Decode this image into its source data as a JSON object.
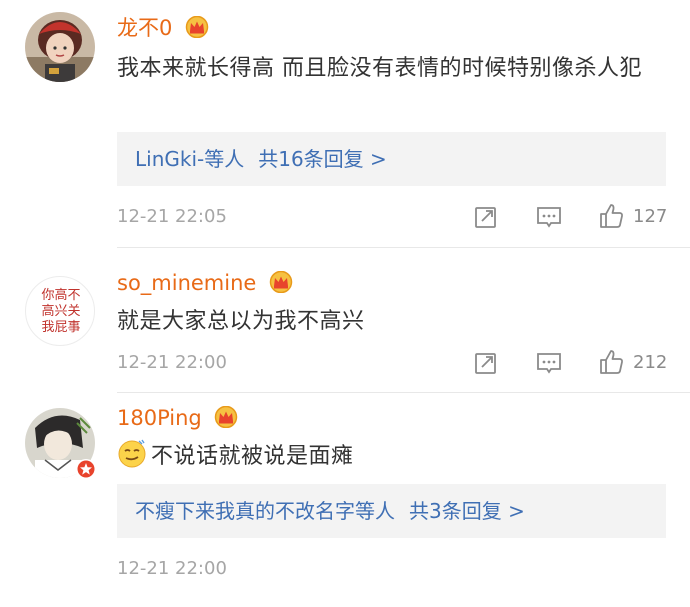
{
  "comments": [
    {
      "username": "龙不0",
      "text": "我本来就长得高  而且脸没有表情的时候特别像杀人犯",
      "replies": {
        "users": "LinGki-等人",
        "count": "共16条回复 >"
      },
      "time": "12-21 22:05",
      "likes": "127"
    },
    {
      "username": "so_minemine",
      "avatar_text": "你高不高兴关我屁事",
      "text": "就是大家总以为我不高兴",
      "time": "12-21 22:00",
      "likes": "212"
    },
    {
      "username": "180Ping",
      "text": "不说话就被说是面瘫",
      "replies": {
        "users": "不瘦下来我真的不改名字等人",
        "count": "共3条回复 >"
      },
      "time": "12-21 22:00"
    }
  ],
  "colors": {
    "username": "#e86a17",
    "link": "#3f6fb4",
    "time": "#a6a6a6"
  },
  "icons": [
    "crown-badge-icon",
    "share-icon",
    "comment-icon",
    "thumbs-up-icon",
    "verified-badge-icon",
    "smirk-emoji-icon"
  ]
}
